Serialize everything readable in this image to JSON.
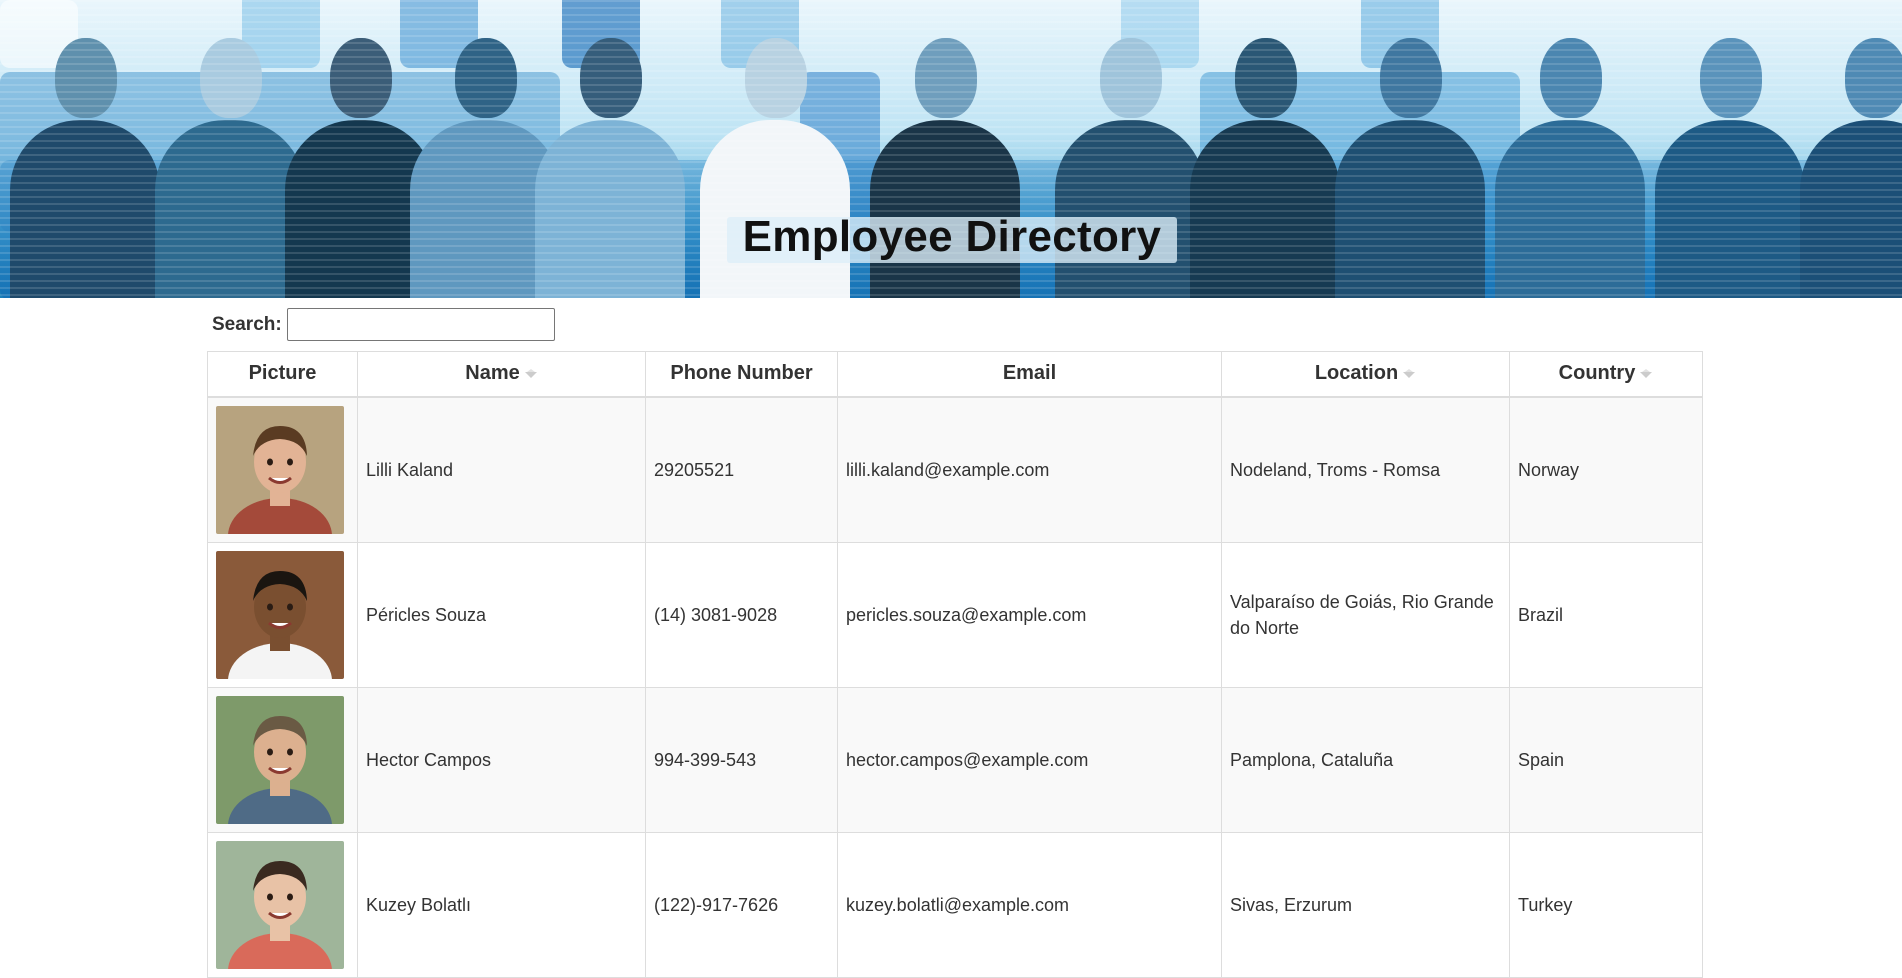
{
  "banner": {
    "title": "Employee Directory"
  },
  "search": {
    "label": "Search:",
    "value": "",
    "placeholder": ""
  },
  "table": {
    "columns": [
      {
        "label": "Picture",
        "sortable": false
      },
      {
        "label": "Name",
        "sortable": true
      },
      {
        "label": "Phone Number",
        "sortable": false
      },
      {
        "label": "Email",
        "sortable": false
      },
      {
        "label": "Location",
        "sortable": true
      },
      {
        "label": "Country",
        "sortable": true
      }
    ],
    "rows": [
      {
        "name": "Lilli Kaland",
        "phone": "29205521",
        "email": "lilli.kaland@example.com",
        "location": "Nodeland, Troms - Romsa",
        "country": "Norway"
      },
      {
        "name": "Péricles Souza",
        "phone": "(14) 3081-9028",
        "email": "pericles.souza@example.com",
        "location": "Valparaíso de Goiás, Rio Grande do Norte",
        "country": "Brazil"
      },
      {
        "name": "Hector Campos",
        "phone": "994-399-543",
        "email": "hector.campos@example.com",
        "location": "Pamplona, Cataluña",
        "country": "Spain"
      },
      {
        "name": "Kuzey Bolatlı",
        "phone": "(122)-917-7626",
        "email": "kuzey.bolatli@example.com",
        "location": "Sivas, Erzurum",
        "country": "Turkey"
      }
    ]
  },
  "colors": {
    "banner_dark": "#1b7fb8",
    "banner_light": "#bfe4f4",
    "row_stripe": "#f9f9f9",
    "border": "#dddddd",
    "text": "#333333"
  },
  "icons": {
    "sort": "sort-caret-icon",
    "avatar": "person-photo"
  }
}
